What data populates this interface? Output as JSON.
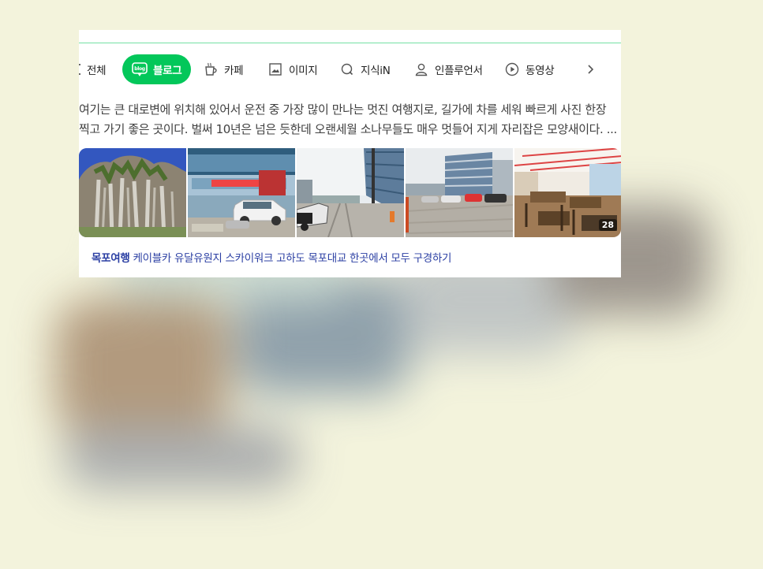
{
  "tabs": [
    {
      "label": "전체",
      "icon": "all-icon"
    },
    {
      "label": "블로그",
      "icon": "blog-icon",
      "badge": "blog",
      "active": true
    },
    {
      "label": "카페",
      "icon": "cafe-icon"
    },
    {
      "label": "이미지",
      "icon": "image-icon"
    },
    {
      "label": "지식iN",
      "icon": "knowledge-icon"
    },
    {
      "label": "인플루언서",
      "icon": "person-icon"
    },
    {
      "label": "동영상",
      "icon": "play-icon"
    }
  ],
  "snippet": {
    "line1": "여기는 큰 대로변에 위치해 있어서 운전 중 가장 많이 만나는 멋진 여행지로, 길가에 차를 세워 빠르게 사진 한장",
    "line2": "찍고 가기 좋은 곳이다. 벌써 10년은 넘은 듯한데 오랜세월 소나무들도 매우 멋들어 지게 자리잡은 모양새이다. ..."
  },
  "images": {
    "count_label": "28"
  },
  "related": {
    "keyword": "목포여행",
    "text": "케이블카 유달유원지 스카이워크 고하도 목포대교 한곳에서 모두 구경하기"
  },
  "colors": {
    "accent": "#03c75a",
    "link": "#2b3fa3",
    "background": "#f3f3dc"
  }
}
